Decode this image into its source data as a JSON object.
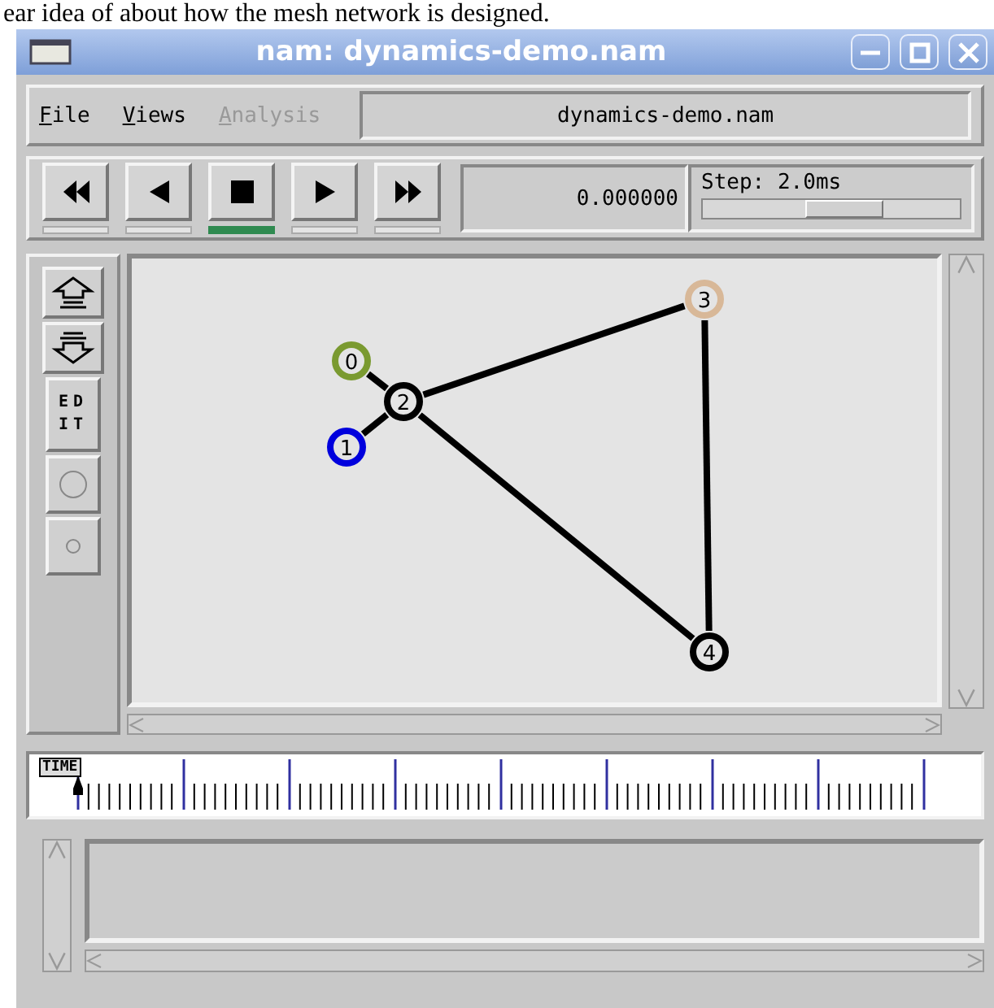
{
  "document_text": "ear idea of about how the mesh network is designed.",
  "window": {
    "title": "nam: dynamics-demo.nam"
  },
  "menu": [
    {
      "label": "File",
      "disabled": false
    },
    {
      "label": "Views",
      "disabled": false
    },
    {
      "label": "Analysis",
      "disabled": true
    }
  ],
  "file_name": "dynamics-demo.nam",
  "playback": {
    "buttons": [
      {
        "kind": "rewind",
        "selected": false
      },
      {
        "kind": "back",
        "selected": false
      },
      {
        "kind": "stop",
        "selected": true
      },
      {
        "kind": "play",
        "selected": false
      },
      {
        "kind": "forward",
        "selected": false
      }
    ],
    "time": "0.000000",
    "step": {
      "label": "Step: 2.0ms",
      "level": 0.55
    }
  },
  "tools": {
    "edit_label": "EDIT"
  },
  "network": {
    "nodes": [
      {
        "label": "0",
        "color": "#7a9a30"
      },
      {
        "label": "1",
        "color": "#0000dd"
      },
      {
        "label": "2",
        "color": "#000000"
      },
      {
        "label": "3",
        "color": "#d8b898"
      },
      {
        "label": "4",
        "color": "#000000"
      }
    ]
  },
  "timeline": {
    "label": "TIME",
    "level": 0
  }
}
